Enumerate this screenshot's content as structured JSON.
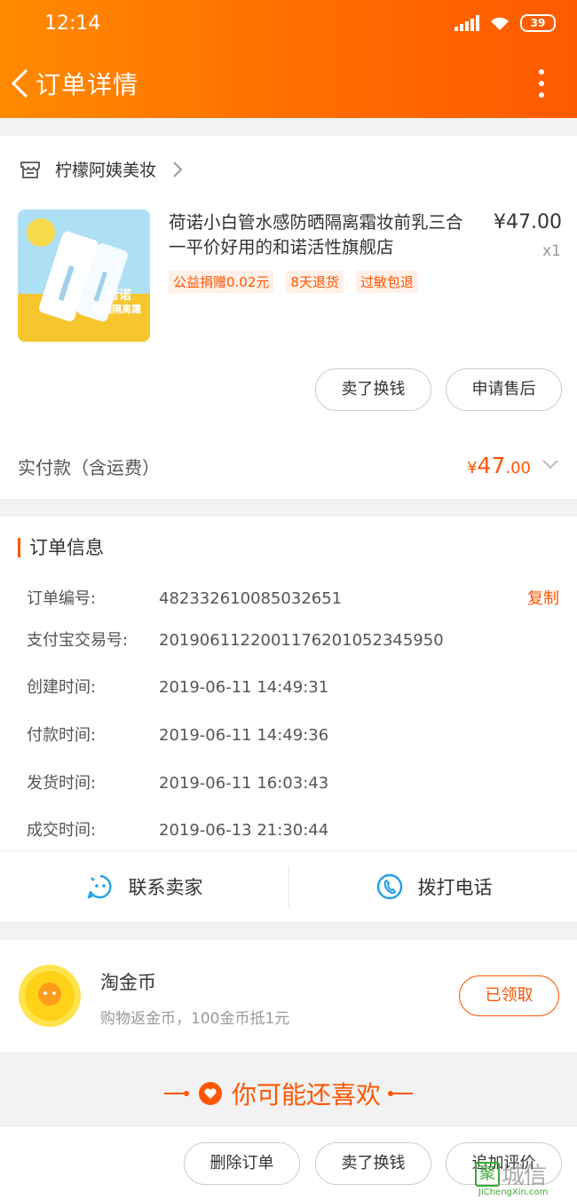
{
  "status_bar": {
    "time": "12:14",
    "battery": "39"
  },
  "nav": {
    "title": "订单详情"
  },
  "shop": {
    "name": "柠檬阿姨美妆"
  },
  "product": {
    "title": "荷诺小白管水感防晒隔离霜妆前乳三合一平价好用的和诺活性旗舰店",
    "price": "¥47.00",
    "quantity": "x1",
    "image_text": "荷诺",
    "image_subtext": "防晒隔离霜",
    "tags": [
      "公益捐赠0.02元",
      "8天退货",
      "过敏包退"
    ]
  },
  "item_actions": {
    "sell": "卖了换钱",
    "after_sale": "申请售后"
  },
  "payment": {
    "label": "实付款（含运费）",
    "currency": "¥",
    "integer": "47",
    "decimal": ".00"
  },
  "order_info": {
    "title": "订单信息",
    "copy": "复制",
    "rows": [
      {
        "label": "订单编号:",
        "value": "482332610085032651"
      },
      {
        "label": "支付宝交易号:",
        "value": "2019061122001176201052345950"
      },
      {
        "label": "创建时间:",
        "value": "2019-06-11 14:49:31"
      },
      {
        "label": "付款时间:",
        "value": "2019-06-11 14:49:36"
      },
      {
        "label": "发货时间:",
        "value": "2019-06-11 16:03:43"
      },
      {
        "label": "成交时间:",
        "value": "2019-06-13 21:30:44"
      }
    ]
  },
  "contact": {
    "seller": "联系卖家",
    "phone": "拨打电话"
  },
  "coins": {
    "title": "淘金币",
    "subtitle": "购物返金币，100金币抵1元",
    "button": "已领取"
  },
  "recommend": {
    "title": "你可能还喜欢"
  },
  "bottom_actions": {
    "delete": "删除订单",
    "sell": "卖了换钱",
    "review": "追加评价"
  },
  "watermark": {
    "logo_char": "聚",
    "chars": "城信",
    "url": "JiChengXin.com"
  },
  "colors": {
    "accent": "#ff5500",
    "header_start": "#ff8a00",
    "header_end": "#ff5a00"
  }
}
